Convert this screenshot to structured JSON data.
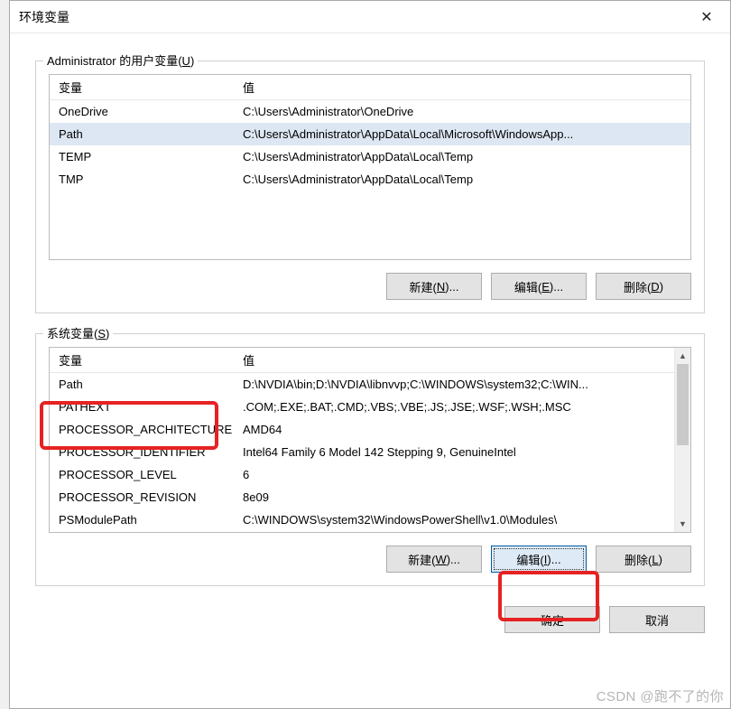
{
  "window": {
    "title": "环境变量"
  },
  "user_section": {
    "legend": "Administrator 的用户变量",
    "legend_ak": "U",
    "columns": {
      "var": "变量",
      "val": "值"
    },
    "rows": [
      {
        "var": "OneDrive",
        "val": "C:\\Users\\Administrator\\OneDrive"
      },
      {
        "var": "Path",
        "val": "C:\\Users\\Administrator\\AppData\\Local\\Microsoft\\WindowsApp...",
        "selected": true
      },
      {
        "var": "TEMP",
        "val": "C:\\Users\\Administrator\\AppData\\Local\\Temp"
      },
      {
        "var": "TMP",
        "val": "C:\\Users\\Administrator\\AppData\\Local\\Temp"
      }
    ],
    "buttons": {
      "new": {
        "label": "新建(",
        "ak": "N",
        "suffix": ")..."
      },
      "edit": {
        "label": "编辑(",
        "ak": "E",
        "suffix": ")..."
      },
      "del": {
        "label": "删除(",
        "ak": "D",
        "suffix": ")"
      }
    }
  },
  "sys_section": {
    "legend": "系统变量",
    "legend_ak": "S",
    "columns": {
      "var": "变量",
      "val": "值"
    },
    "rows": [
      {
        "var": "Path",
        "val": "D:\\NVDIA\\bin;D:\\NVDIA\\libnvvp;C:\\WINDOWS\\system32;C:\\WIN..."
      },
      {
        "var": "PATHEXT",
        "val": ".COM;.EXE;.BAT;.CMD;.VBS;.VBE;.JS;.JSE;.WSF;.WSH;.MSC"
      },
      {
        "var": "PROCESSOR_ARCHITECTURE",
        "val": "AMD64"
      },
      {
        "var": "PROCESSOR_IDENTIFIER",
        "val": "Intel64 Family 6 Model 142 Stepping 9, GenuineIntel"
      },
      {
        "var": "PROCESSOR_LEVEL",
        "val": "6"
      },
      {
        "var": "PROCESSOR_REVISION",
        "val": "8e09"
      },
      {
        "var": "PSModulePath",
        "val": "C:\\WINDOWS\\system32\\WindowsPowerShell\\v1.0\\Modules\\"
      }
    ],
    "buttons": {
      "new": {
        "label": "新建(",
        "ak": "W",
        "suffix": ")..."
      },
      "edit": {
        "label": "编辑(",
        "ak": "I",
        "suffix": ")...",
        "focused": true
      },
      "del": {
        "label": "删除(",
        "ak": "L",
        "suffix": ")"
      }
    }
  },
  "dialog_buttons": {
    "ok": "确定",
    "cancel": "取消"
  },
  "watermark": "CSDN @跑不了的你"
}
